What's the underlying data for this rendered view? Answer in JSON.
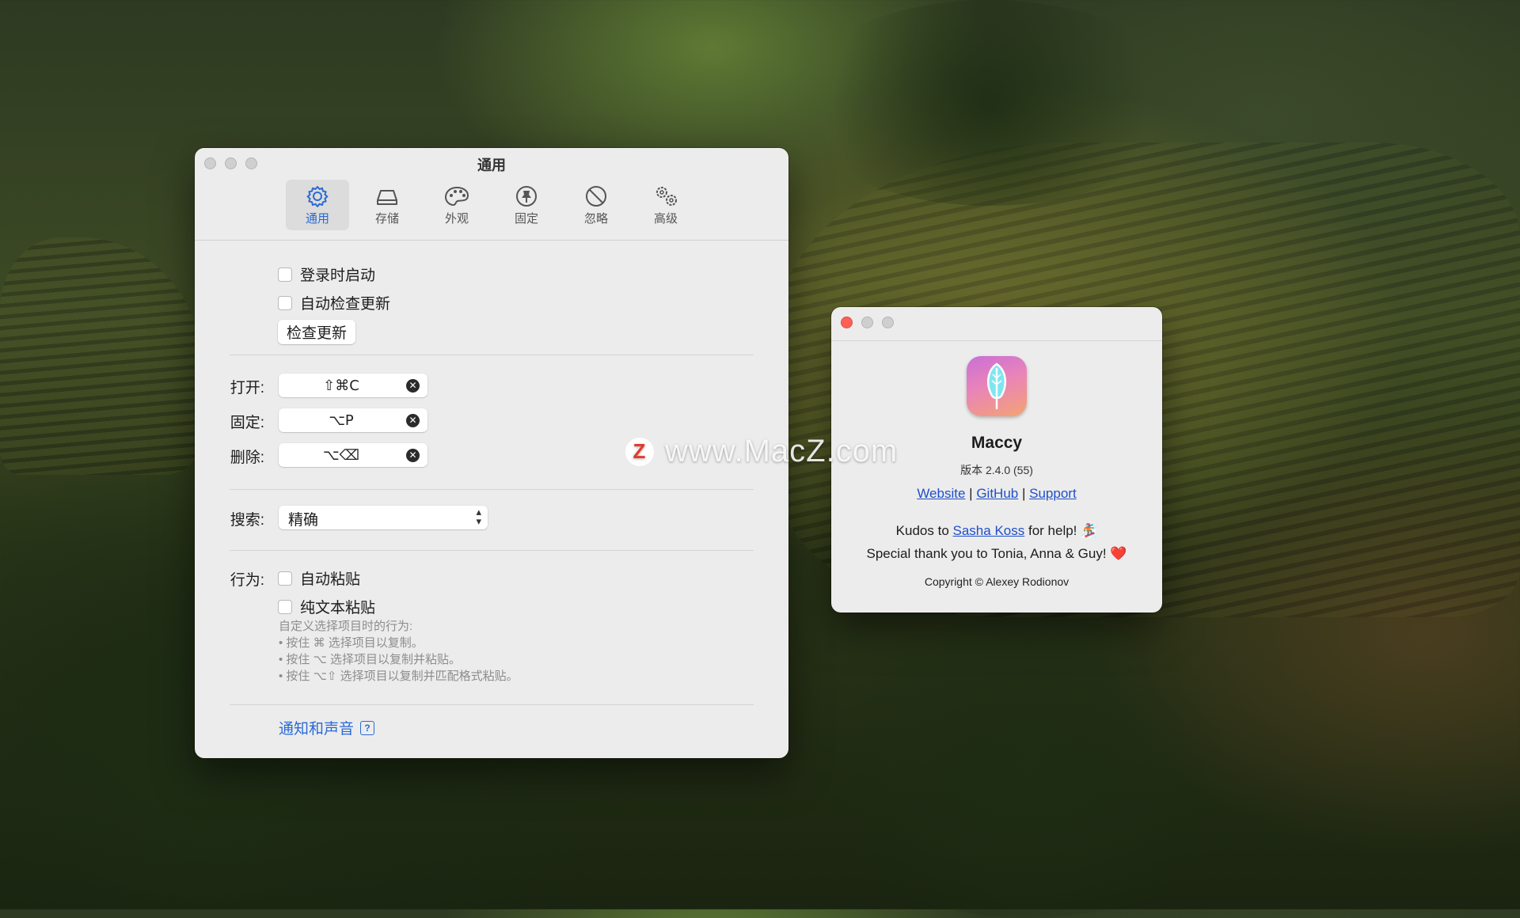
{
  "settings": {
    "title": "通用",
    "tabs": [
      {
        "label": "通用",
        "icon": "gear-icon",
        "active": true
      },
      {
        "label": "存储",
        "icon": "drive-icon",
        "active": false
      },
      {
        "label": "外观",
        "icon": "palette-icon",
        "active": false
      },
      {
        "label": "固定",
        "icon": "pin-icon",
        "active": false
      },
      {
        "label": "忽略",
        "icon": "prohibit-icon",
        "active": false
      },
      {
        "label": "高级",
        "icon": "gears-icon",
        "active": false
      }
    ],
    "launch_at_login": "登录时启动",
    "auto_check_updates": "自动检查更新",
    "check_updates_button": "检查更新",
    "shortcuts": {
      "open_label": "打开:",
      "open_keys": "⇧⌘C",
      "pin_label": "固定:",
      "pin_keys": "⌥P",
      "delete_label": "删除:",
      "delete_keys": "⌥⌫"
    },
    "search_label": "搜索:",
    "search_value": "精确",
    "behavior_label": "行为:",
    "auto_paste": "自动粘贴",
    "plain_text_paste": "纯文本粘贴",
    "help_lines": [
      "自定义选择项目时的行为:",
      "• 按住 ⌘ 选择项目以复制。",
      "• 按住 ⌥ 选择项目以复制并粘贴。",
      "• 按住 ⌥⇧ 选择项目以复制并匹配格式粘贴。"
    ],
    "notifications_link": "通知和声音",
    "help_mark": "?"
  },
  "about": {
    "app_name": "Maccy",
    "version": "版本 2.4.0 (55)",
    "links": {
      "website": "Website",
      "github": "GitHub",
      "support": "Support",
      "sep": "|"
    },
    "kudos_prefix": "Kudos to",
    "kudos_name": "Sasha Koss",
    "kudos_suffix": "for help! 🏂",
    "thanks": "Special thank you to Tonia, Anna & Guy! ❤️",
    "copyright": "Copyright © Alexey Rodionov"
  },
  "watermark": {
    "logo_letter": "Z",
    "text": "www.MacZ.com"
  },
  "colors": {
    "accent": "#2a6ad6",
    "close_red": "#fe5f57",
    "window_bg": "#ececec"
  }
}
